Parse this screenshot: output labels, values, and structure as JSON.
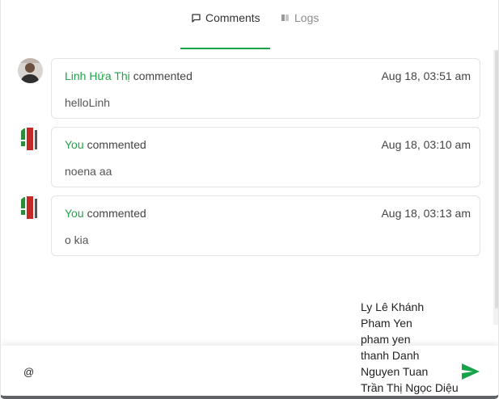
{
  "tabs": [
    {
      "label": "Comments",
      "active": true
    },
    {
      "label": "Logs",
      "active": false
    }
  ],
  "colors": {
    "accent": "#16a34a",
    "author": "#22a34a"
  },
  "comments": [
    {
      "author": "Linh Hứa Thị",
      "verb": "commented",
      "time": "Aug 18, 03:51 am",
      "body": "helloLinh",
      "avatar": "avatar-photo"
    },
    {
      "author": "You",
      "verb": "commented",
      "time": "Aug 18, 03:10 am",
      "body": "noena aa",
      "avatar": "avatar-logo"
    },
    {
      "author": "You",
      "verb": "commented",
      "time": "Aug 18, 03:13 am",
      "body": "o kia",
      "avatar": "avatar-logo"
    }
  ],
  "composer": {
    "value": "@",
    "send_icon": "send-icon"
  },
  "mentions": [
    "Ly Lê Khánh",
    "Pham Yen",
    "pham yen",
    "thanh Danh",
    "Nguyen Tuan",
    "Trần Thị Ngọc Diệu"
  ]
}
